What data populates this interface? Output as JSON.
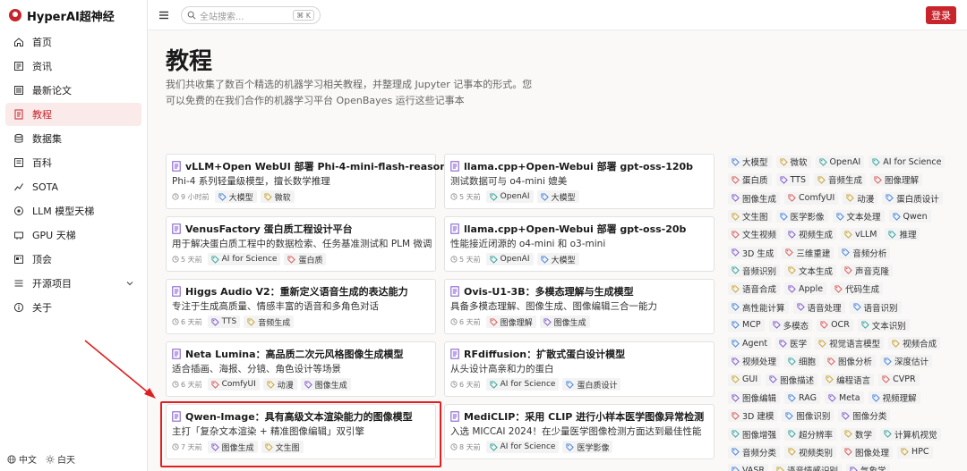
{
  "brand": {
    "name": "HyperAI超神经",
    "color": "#c8242b"
  },
  "sidebar": {
    "items": [
      {
        "label": "首页",
        "icon": "home-icon",
        "active": false
      },
      {
        "label": "资讯",
        "icon": "news-icon",
        "active": false
      },
      {
        "label": "最新论文",
        "icon": "paper-icon",
        "active": false
      },
      {
        "label": "教程",
        "icon": "tutorial-icon",
        "active": true
      },
      {
        "label": "数据集",
        "icon": "dataset-icon",
        "active": false
      },
      {
        "label": "百科",
        "icon": "wiki-icon",
        "active": false
      },
      {
        "label": "SOTA",
        "icon": "sota-icon",
        "active": false
      },
      {
        "label": "LLM 模型天梯",
        "icon": "ladder-icon",
        "active": false
      },
      {
        "label": "GPU 天梯",
        "icon": "gpu-icon",
        "active": false
      },
      {
        "label": "顶会",
        "icon": "conference-icon",
        "active": false
      },
      {
        "label": "开源项目",
        "icon": "open-source-icon",
        "active": false,
        "expandable": true
      },
      {
        "label": "关于",
        "icon": "info-icon",
        "active": false
      }
    ],
    "footer": {
      "language": "中文",
      "theme": "白天"
    }
  },
  "topbar": {
    "search_placeholder": "全站搜索...",
    "search_shortcut": "⌘ K",
    "login_label": "登录"
  },
  "page": {
    "title": "教程",
    "description": "我们共收集了数百个精选的机器学习相关教程，并整理成 Jupyter 记事本的形式。您可以免费的在我们合作的机器学习平台 OpenBayes 运行这些记事本"
  },
  "cards": [
    {
      "title": "vLLM+Open WebUI 部署 Phi-4-mini-flash-reasoning",
      "desc": "Phi-4 系列轻量级模型，擅长数学推理",
      "time": "9 小时前",
      "tags": [
        {
          "label": "大模型",
          "color": "#3d7edb"
        },
        {
          "label": "微软",
          "color": "#c9a227"
        }
      ]
    },
    {
      "title": "llama.cpp+Open-Webui 部署 gpt-oss-120b",
      "desc": "测试数据可与 o4-mini 媲美",
      "time": "5 天前",
      "tags": [
        {
          "label": "OpenAI",
          "color": "#2aa198"
        },
        {
          "label": "大模型",
          "color": "#3d7edb"
        }
      ]
    },
    {
      "title": "VenusFactory 蛋白质工程设计平台",
      "desc": "用于解决蛋白质工程中的数据检索、任务基准测试和 PLM 微调",
      "time": "5 天前",
      "tags": [
        {
          "label": "AI for Science",
          "color": "#2aa198"
        },
        {
          "label": "蛋白质",
          "color": "#d9534f"
        }
      ]
    },
    {
      "title": "llama.cpp+Open-Webui 部署 gpt-oss-20b",
      "desc": "性能接近闭源的 o4-mini 和 o3-mini",
      "time": "5 天前",
      "tags": [
        {
          "label": "OpenAI",
          "color": "#2aa198"
        },
        {
          "label": "大模型",
          "color": "#3d7edb"
        }
      ]
    },
    {
      "title": "Higgs Audio V2：重新定义语音生成的表达能力",
      "desc": "专注于生成高质量、情感丰富的语音和多角色对话",
      "time": "6 天前",
      "tags": [
        {
          "label": "TTS",
          "color": "#7b52c9"
        },
        {
          "label": "音频生成",
          "color": "#c9a227"
        }
      ]
    },
    {
      "title": "Ovis-U1-3B：多模态理解与生成模型",
      "desc": "具备多模态理解、图像生成、图像编辑三合一能力",
      "time": "6 天前",
      "tags": [
        {
          "label": "图像理解",
          "color": "#d9534f"
        },
        {
          "label": "图像生成",
          "color": "#7b52c9"
        }
      ]
    },
    {
      "title": "Neta Lumina：高品质二次元风格图像生成模型",
      "desc": "适合插画、海报、分镜、角色设计等场景",
      "time": "6 天前",
      "tags": [
        {
          "label": "ComfyUI",
          "color": "#d9534f"
        },
        {
          "label": "动漫",
          "color": "#c9a227"
        },
        {
          "label": "图像生成",
          "color": "#7b52c9"
        }
      ]
    },
    {
      "title": "RFdiffusion：扩散式蛋白设计模型",
      "desc": "从头设计高亲和力的蛋白",
      "time": "6 天前",
      "tags": [
        {
          "label": "AI for Science",
          "color": "#2aa198"
        },
        {
          "label": "蛋白质设计",
          "color": "#3d7edb"
        }
      ]
    },
    {
      "title": "Qwen-Image：具有高级文本渲染能力的图像模型",
      "desc": "主打「复杂文本渲染 + 精准图像编辑」双引擎",
      "time": "7 天前",
      "tags": [
        {
          "label": "图像生成",
          "color": "#7b52c9"
        },
        {
          "label": "文生图",
          "color": "#c9a227"
        }
      ]
    },
    {
      "title": "MediCLIP：采用 CLIP 进行小样本医学图像异常检测",
      "desc": "入选 MICCAI 2024！在少量医学图像检测方面达到最佳性能",
      "time": "8 天前",
      "tags": [
        {
          "label": "AI for Science",
          "color": "#2aa198"
        },
        {
          "label": "医学影像",
          "color": "#3d7edb"
        }
      ]
    }
  ],
  "tag_cloud": [
    [
      {
        "label": "大模型",
        "color": "#3d7edb"
      },
      {
        "label": "微软",
        "color": "#c9a227"
      },
      {
        "label": "OpenAI",
        "color": "#2aa198"
      },
      {
        "label": "AI for Science",
        "color": "#2aa198"
      }
    ],
    [
      {
        "label": "蛋白质",
        "color": "#d9534f"
      },
      {
        "label": "TTS",
        "color": "#7b52c9"
      },
      {
        "label": "音频生成",
        "color": "#c9a227"
      },
      {
        "label": "图像理解",
        "color": "#d9534f"
      }
    ],
    [
      {
        "label": "图像生成",
        "color": "#7b52c9"
      },
      {
        "label": "ComfyUI",
        "color": "#d9534f"
      },
      {
        "label": "动漫",
        "color": "#c9a227"
      },
      {
        "label": "蛋白质设计",
        "color": "#3d7edb"
      }
    ],
    [
      {
        "label": "文生图",
        "color": "#c9a227"
      },
      {
        "label": "医学影像",
        "color": "#3d7edb"
      },
      {
        "label": "文本处理",
        "color": "#3d7edb"
      },
      {
        "label": "Qwen",
        "color": "#3d7edb"
      }
    ],
    [
      {
        "label": "文生视频",
        "color": "#d9534f"
      },
      {
        "label": "视频生成",
        "color": "#7b52c9"
      },
      {
        "label": "vLLM",
        "color": "#c9a227"
      },
      {
        "label": "推理",
        "color": "#2aa198"
      }
    ],
    [
      {
        "label": "3D 生成",
        "color": "#7b52c9"
      },
      {
        "label": "三维重建",
        "color": "#d9534f"
      },
      {
        "label": "音频分析",
        "color": "#3d7edb"
      }
    ],
    [
      {
        "label": "音频识别",
        "color": "#2aa198"
      },
      {
        "label": "文本生成",
        "color": "#c9a227"
      },
      {
        "label": "声音克隆",
        "color": "#d9534f"
      }
    ],
    [
      {
        "label": "语音合成",
        "color": "#c9a227"
      },
      {
        "label": "Apple",
        "color": "#7b52c9"
      },
      {
        "label": "代码生成",
        "color": "#d9534f"
      }
    ],
    [
      {
        "label": "高性能计算",
        "color": "#3d7edb"
      },
      {
        "label": "语音处理",
        "color": "#7b52c9"
      },
      {
        "label": "语音识别",
        "color": "#3d7edb"
      }
    ],
    [
      {
        "label": "MCP",
        "color": "#3d7edb"
      },
      {
        "label": "多模态",
        "color": "#7b52c9"
      },
      {
        "label": "OCR",
        "color": "#d9534f"
      },
      {
        "label": "文本识别",
        "color": "#2aa198"
      }
    ],
    [
      {
        "label": "Agent",
        "color": "#3d7edb"
      },
      {
        "label": "医学",
        "color": "#7b52c9"
      },
      {
        "label": "视觉语言模型",
        "color": "#c9a227"
      },
      {
        "label": "视频合成",
        "color": "#c9a227"
      }
    ],
    [
      {
        "label": "视频处理",
        "color": "#7b52c9"
      },
      {
        "label": "细胞",
        "color": "#2aa198"
      },
      {
        "label": "图像分析",
        "color": "#d9534f"
      },
      {
        "label": "深度估计",
        "color": "#3d7edb"
      }
    ],
    [
      {
        "label": "GUI",
        "color": "#c9a227"
      },
      {
        "label": "图像描述",
        "color": "#7b52c9"
      },
      {
        "label": "编程语言",
        "color": "#c9a227"
      },
      {
        "label": "CVPR",
        "color": "#d9534f"
      }
    ],
    [
      {
        "label": "图像编辑",
        "color": "#7b52c9"
      },
      {
        "label": "RAG",
        "color": "#3d7edb"
      },
      {
        "label": "Meta",
        "color": "#7b52c9"
      },
      {
        "label": "视频理解",
        "color": "#3d7edb"
      }
    ],
    [
      {
        "label": "3D 建模",
        "color": "#d9534f"
      },
      {
        "label": "图像识别",
        "color": "#3d7edb"
      },
      {
        "label": "图像分类",
        "color": "#7b52c9"
      }
    ],
    [
      {
        "label": "图像增强",
        "color": "#2aa198"
      },
      {
        "label": "超分辨率",
        "color": "#2aa198"
      },
      {
        "label": "数学",
        "color": "#c9a227"
      },
      {
        "label": "计算机视觉",
        "color": "#2aa198"
      }
    ],
    [
      {
        "label": "音频分类",
        "color": "#3d7edb"
      },
      {
        "label": "视频类别",
        "color": "#c9a227"
      },
      {
        "label": "图像处理",
        "color": "#d9534f"
      },
      {
        "label": "HPC",
        "color": "#c9a227"
      }
    ],
    [
      {
        "label": "VASR",
        "color": "#3d7edb"
      },
      {
        "label": "语音情感识别",
        "color": "#c9a227"
      },
      {
        "label": "气象学",
        "color": "#7b52c9"
      }
    ]
  ],
  "colors": {
    "accent": "#c8242b",
    "highlight": "#e02020"
  }
}
